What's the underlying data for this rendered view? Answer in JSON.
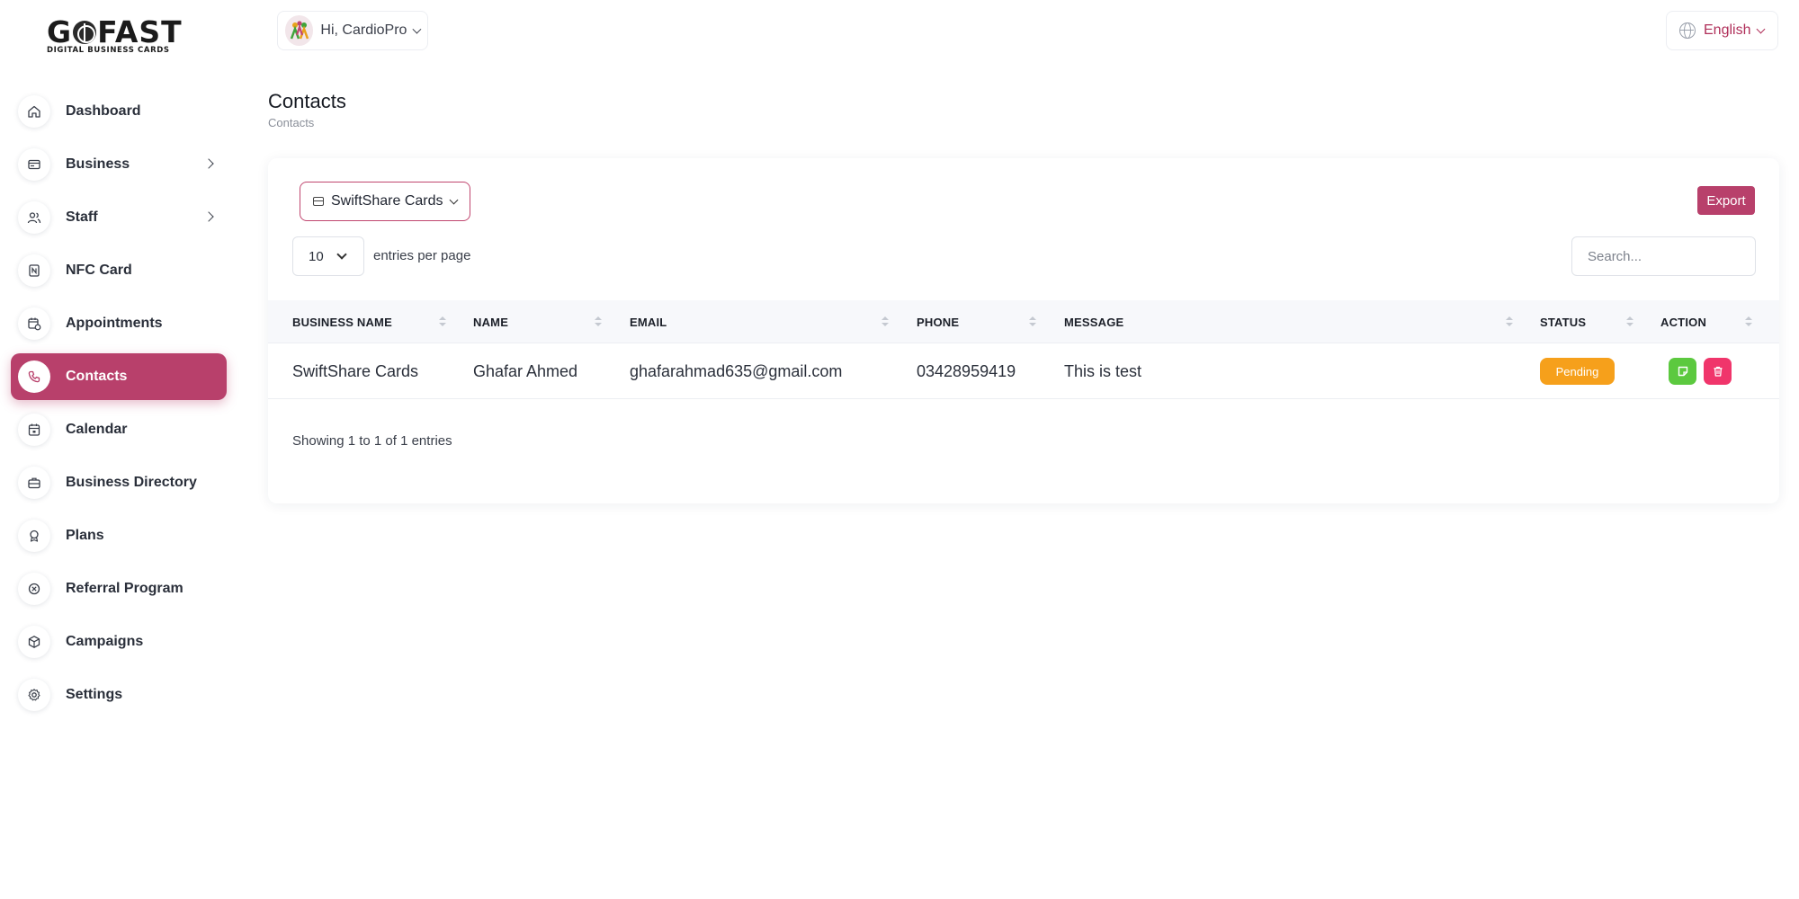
{
  "logo": {
    "main_prefix": "G",
    "main_suffix": "FAST",
    "subtitle": "DIGITAL BUSINESS CARDS"
  },
  "header": {
    "greeting": "Hi, CardioPro",
    "language": "English"
  },
  "sidebar": {
    "items": [
      {
        "label": "Dashboard",
        "icon": "home-icon"
      },
      {
        "label": "Business",
        "icon": "id-card-icon",
        "has_submenu": true
      },
      {
        "label": "Staff",
        "icon": "users-icon",
        "has_submenu": true
      },
      {
        "label": "NFC Card",
        "icon": "nfc-icon"
      },
      {
        "label": "Appointments",
        "icon": "calendar-clock-icon"
      },
      {
        "label": "Contacts",
        "icon": "phone-icon",
        "active": true
      },
      {
        "label": "Calendar",
        "icon": "calendar-icon"
      },
      {
        "label": "Business Directory",
        "icon": "briefcase-icon"
      },
      {
        "label": "Plans",
        "icon": "award-icon"
      },
      {
        "label": "Referral Program",
        "icon": "referral-icon"
      },
      {
        "label": "Campaigns",
        "icon": "box-icon"
      },
      {
        "label": "Settings",
        "icon": "gear-icon"
      }
    ]
  },
  "page": {
    "title": "Contacts",
    "breadcrumb": "Contacts"
  },
  "toolbar": {
    "business_filter": "SwiftShare Cards",
    "export_label": "Export",
    "entries_value": "10",
    "entries_label": "entries per page",
    "search_placeholder": "Search..."
  },
  "table": {
    "columns": [
      "BUSINESS NAME",
      "NAME",
      "EMAIL",
      "PHONE",
      "MESSAGE",
      "STATUS",
      "ACTION"
    ],
    "rows": [
      {
        "business_name": "SwiftShare Cards",
        "name": "Ghafar Ahmed",
        "email": "ghafarahmad635@gmail.com",
        "phone": "03428959419",
        "message": "This is test",
        "status": "Pending"
      }
    ],
    "footer": "Showing 1 to 1 of 1 entries"
  },
  "colors": {
    "accent": "#b8406b",
    "pending": "#f6a01b",
    "edit": "#5cc93f",
    "delete": "#f0356b"
  }
}
